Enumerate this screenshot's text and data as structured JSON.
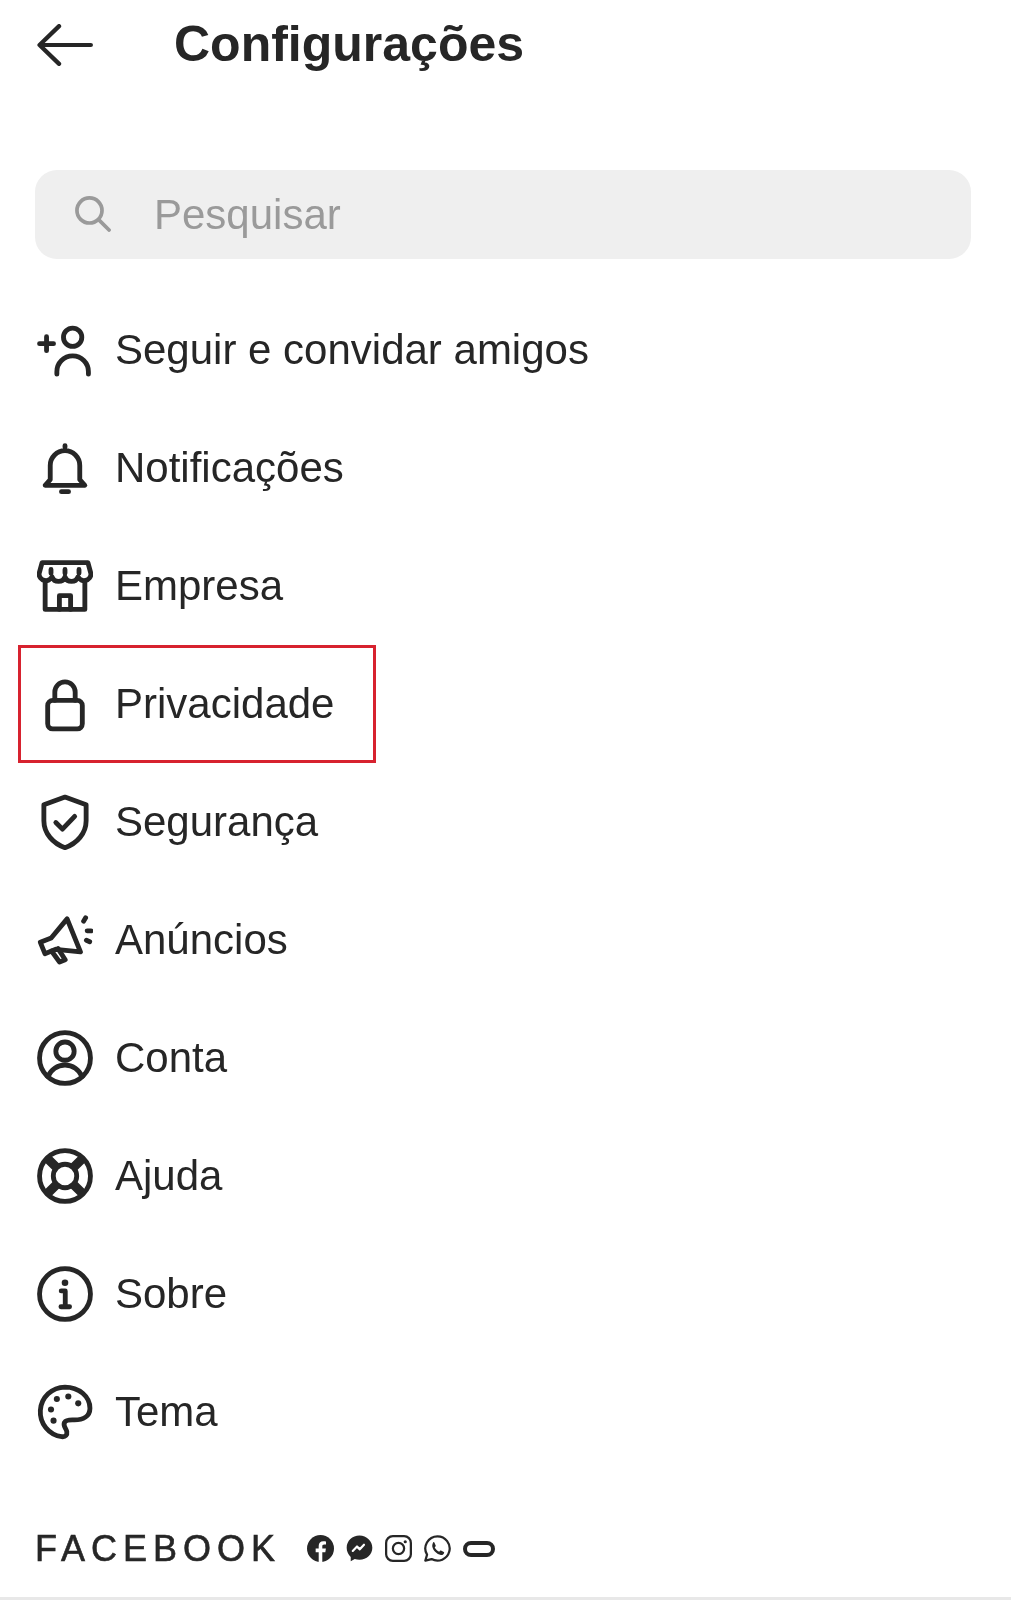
{
  "header": {
    "title": "Configurações"
  },
  "search": {
    "placeholder": "Pesquisar"
  },
  "menu": [
    {
      "label": "Seguir e convidar amigos",
      "highlighted": false
    },
    {
      "label": "Notificações",
      "highlighted": false
    },
    {
      "label": "Empresa",
      "highlighted": false
    },
    {
      "label": "Privacidade",
      "highlighted": true
    },
    {
      "label": "Segurança",
      "highlighted": false
    },
    {
      "label": "Anúncios",
      "highlighted": false
    },
    {
      "label": "Conta",
      "highlighted": false
    },
    {
      "label": "Ajuda",
      "highlighted": false
    },
    {
      "label": "Sobre",
      "highlighted": false
    },
    {
      "label": "Tema",
      "highlighted": false
    }
  ],
  "footer": {
    "brand": "FACEBOOK"
  }
}
